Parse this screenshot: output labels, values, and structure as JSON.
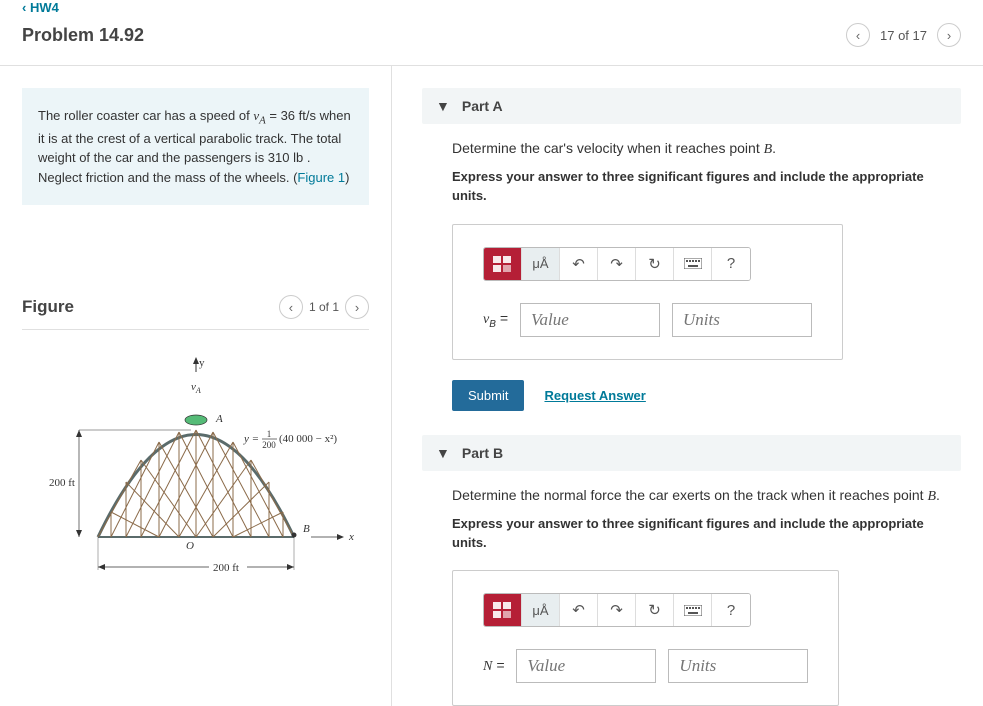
{
  "breadcrumb": "HW4",
  "problem_title": "Problem 14.92",
  "pager": {
    "text": "17 of 17"
  },
  "prompt": {
    "t1": "The roller coaster car has a speed of ",
    "var1": "v",
    "sub1": "A",
    "t2": " = 36 ",
    "unit1": "ft/s",
    "t3": " when it is at the crest of a vertical parabolic track. The total weight of the car and the passengers is 310 ",
    "unit2": "lb",
    "t4": " . Neglect friction and the mass of the wheels. (",
    "link": "Figure 1",
    "t5": ")"
  },
  "figure": {
    "heading": "Figure",
    "pager": "1 of 1",
    "labels": {
      "y": "y",
      "vA": "v",
      "vA_sub": "A",
      "A": "A",
      "eq_prefix": "y = ",
      "eq_num": "1",
      "eq_den": "200",
      "eq_rest": " (40 000 − x²)",
      "h200": "200 ft",
      "B": "B",
      "x": "x",
      "O": "O",
      "w200": "200 ft"
    }
  },
  "partA": {
    "title": "Part A",
    "question_t1": "Determine the car's velocity when it reaches point ",
    "question_var": "B",
    "question_t2": ".",
    "instruct": "Express your answer to three significant figures and include the appropriate units.",
    "eq_var": "v",
    "eq_sub": "B",
    "eq_eq": " =",
    "value_ph": "Value",
    "units_ph": "Units",
    "submit": "Submit",
    "request": "Request Answer",
    "greek_label": "μÅ"
  },
  "partB": {
    "title": "Part B",
    "question_t1": "Determine the normal force the car exerts on the track when it reaches point ",
    "question_var": "B",
    "question_t2": ".",
    "instruct": "Express your answer to three significant figures and include the appropriate units.",
    "eq_var": "N",
    "eq_eq": " =",
    "value_ph": "Value",
    "units_ph": "Units",
    "greek_label": "μÅ"
  }
}
